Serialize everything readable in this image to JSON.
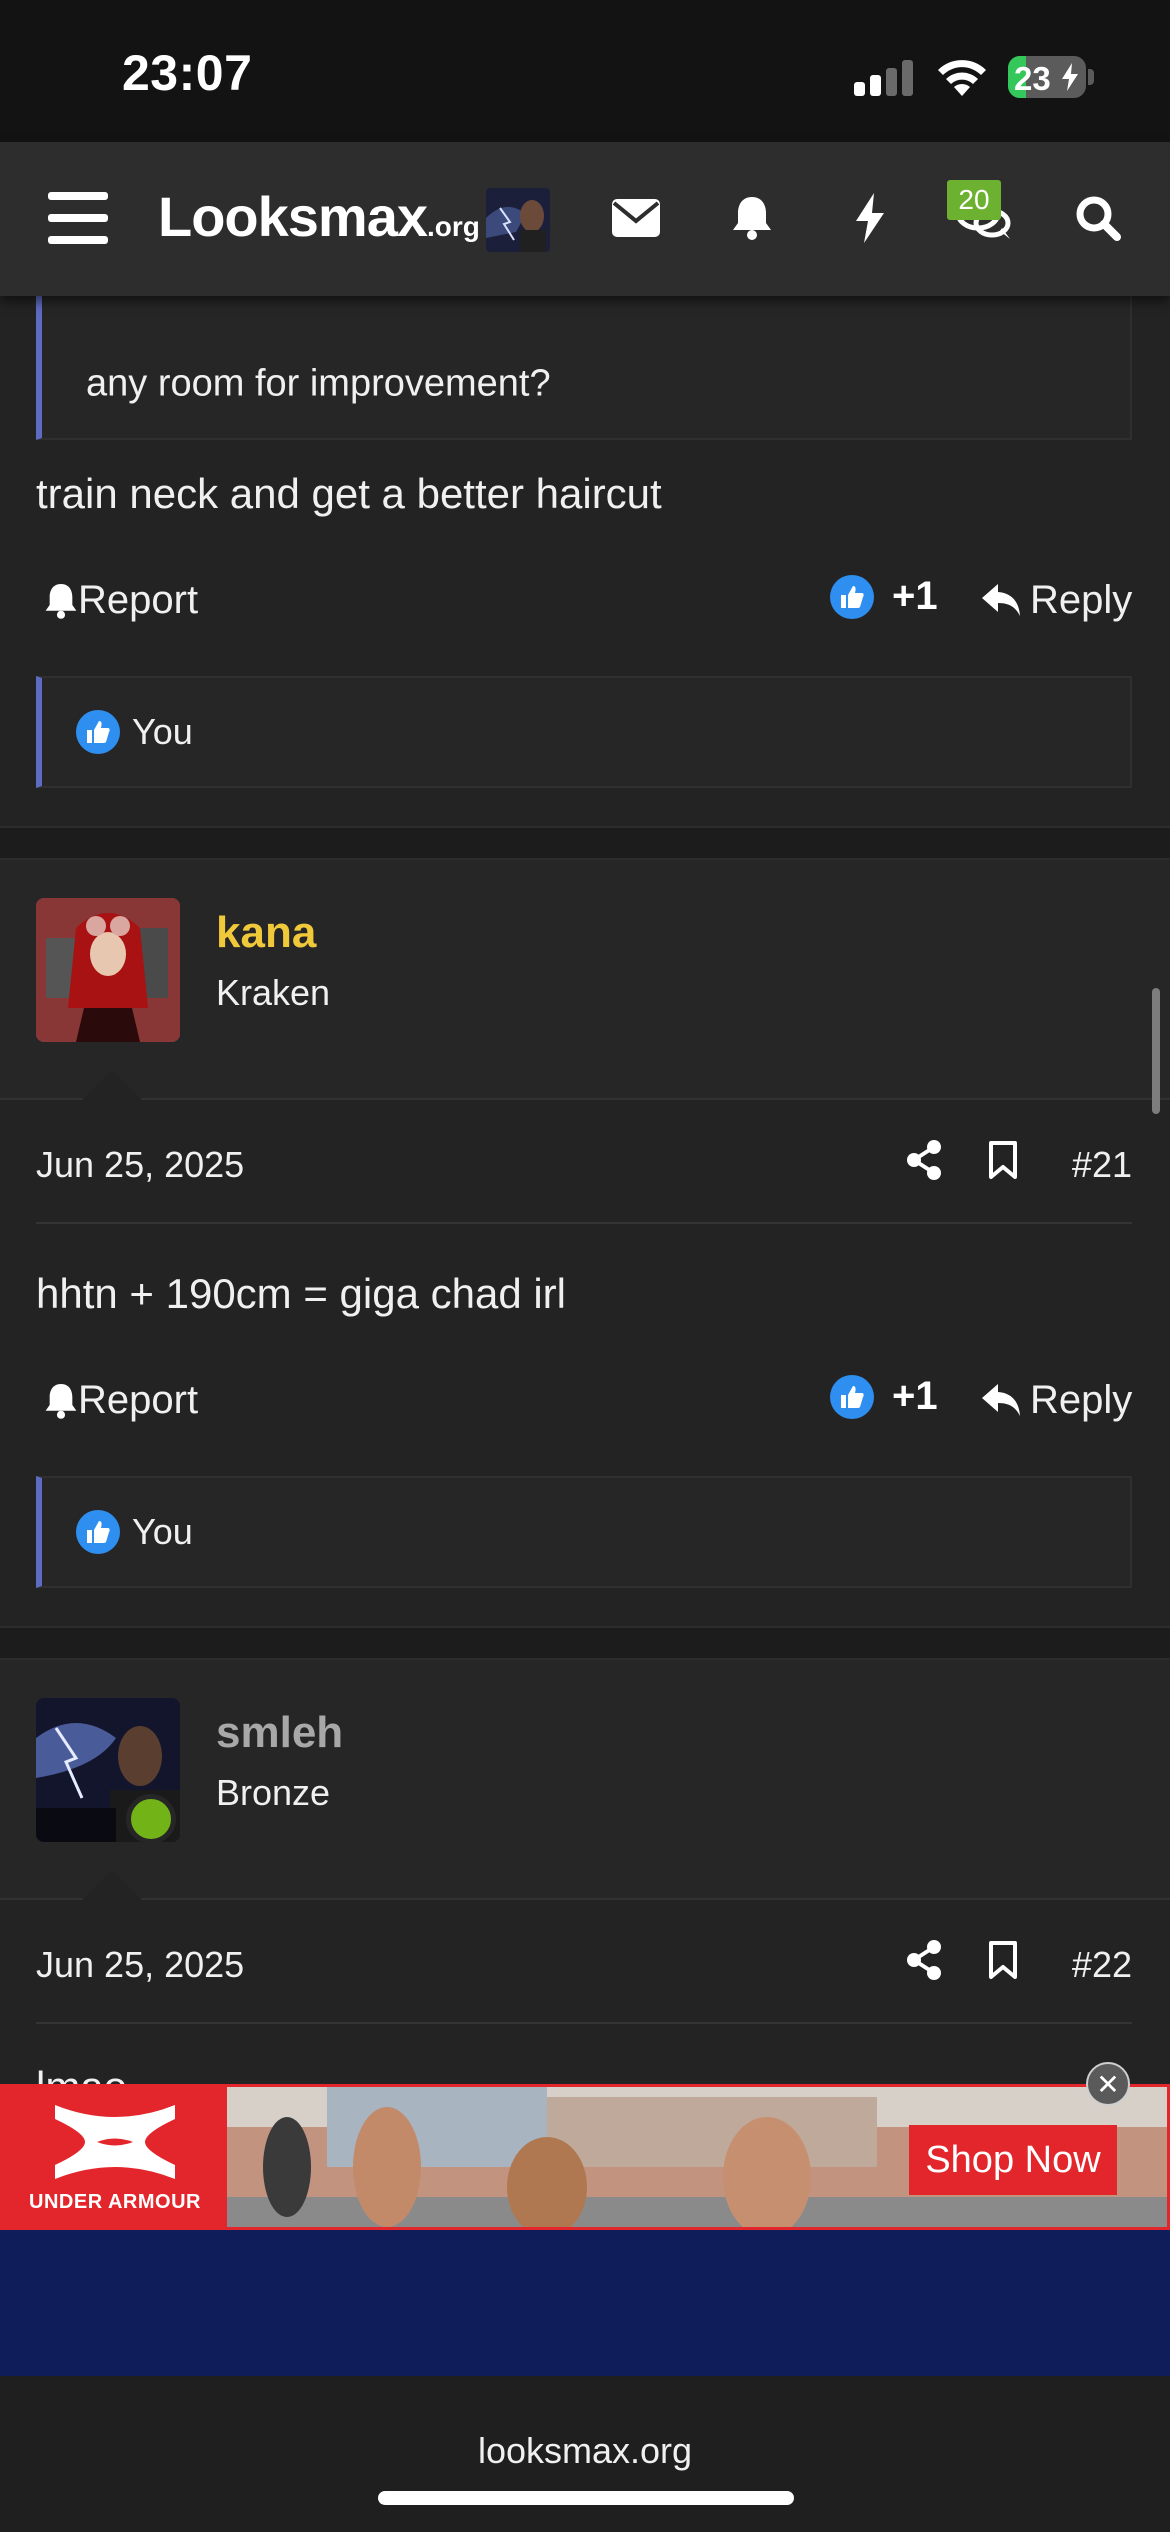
{
  "status_bar": {
    "time": "23:07",
    "battery": "23"
  },
  "header": {
    "logo_main": "Looksmax",
    "logo_suffix": ".org",
    "notification_count": "20"
  },
  "posts": [
    {
      "quote": "any room for improvement?",
      "body": "train neck and get a better haircut",
      "report_label": "Report",
      "like_count": "+1",
      "reply_label": "Reply",
      "reaction_user": "You"
    },
    {
      "username": "kana",
      "username_color": "#f0c93a",
      "user_title": "Kraken",
      "date": "Jun 25, 2025",
      "post_number": "#21",
      "body": "hhtn + 190cm = giga chad irl",
      "report_label": "Report",
      "like_count": "+1",
      "reply_label": "Reply",
      "reaction_user": "You"
    },
    {
      "username": "smleh",
      "username_color": "#a8a8a8",
      "user_title": "Bronze",
      "date": "Jun 25, 2025",
      "post_number": "#22",
      "body_partial": "lmao"
    }
  ],
  "ad": {
    "brand": "UNDER ARMOUR",
    "cta": "Shop Now"
  },
  "browser": {
    "url": "looksmax.org"
  },
  "colors": {
    "accent_quote": "#5d6bc0",
    "like_blue": "#2f8ff0",
    "online_green": "#72b417",
    "badge_green": "#6cb12f",
    "ad_red": "#e3262b"
  }
}
